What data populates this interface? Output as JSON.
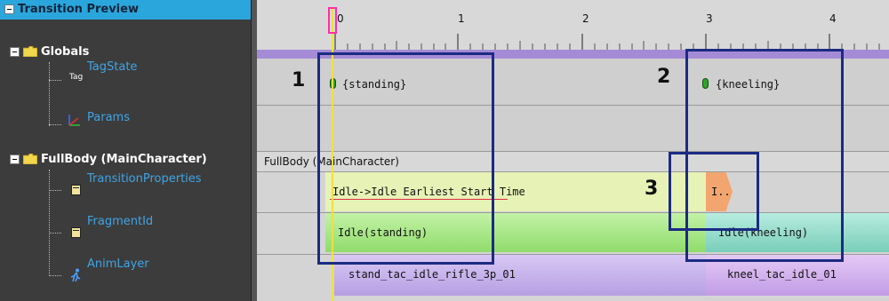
{
  "tree": {
    "header": "Transition Preview",
    "globals": "Globals",
    "tag_icon": "Tag",
    "tagstate": "TagState",
    "params": "Params",
    "fullbody": "FullBody (MainCharacter)",
    "transition_properties": "TransitionProperties",
    "fragment_id": "FragmentId",
    "anim_layer": "AnimLayer"
  },
  "timeline": {
    "ruler_labels": [
      "0",
      "1",
      "2",
      "3",
      "4"
    ],
    "fullbody_label": "FullBody (MainCharacter)",
    "callouts": [
      "1",
      "2",
      "3"
    ],
    "tag_standing": "{standing}",
    "tag_kneeling": "{kneeling}",
    "transition_clip": "Idle->Idle Earliest Start Time",
    "transition_short": "I..",
    "frag_standing": "Idle(standing)",
    "frag_kneeling": "Idle(kneeling)",
    "anim_standing": "stand_tac_idle_rifle_3p_01",
    "anim_kneeling": "kneel_tac_idle_01"
  },
  "colors": {
    "header_bg": "#2aa6dc",
    "tree_bg": "#3c3c3c",
    "leaf_text": "#3fa4e6",
    "callout_box": "#1b2b82",
    "purple_bar": "#a58bd6",
    "transition_clip": "#e7f2b6",
    "transition_short": "#f2a56e",
    "frag_standing": "#a7e57e",
    "frag_kneeling": "#8fd8c7",
    "anim_clip": "#c9b4ee"
  }
}
